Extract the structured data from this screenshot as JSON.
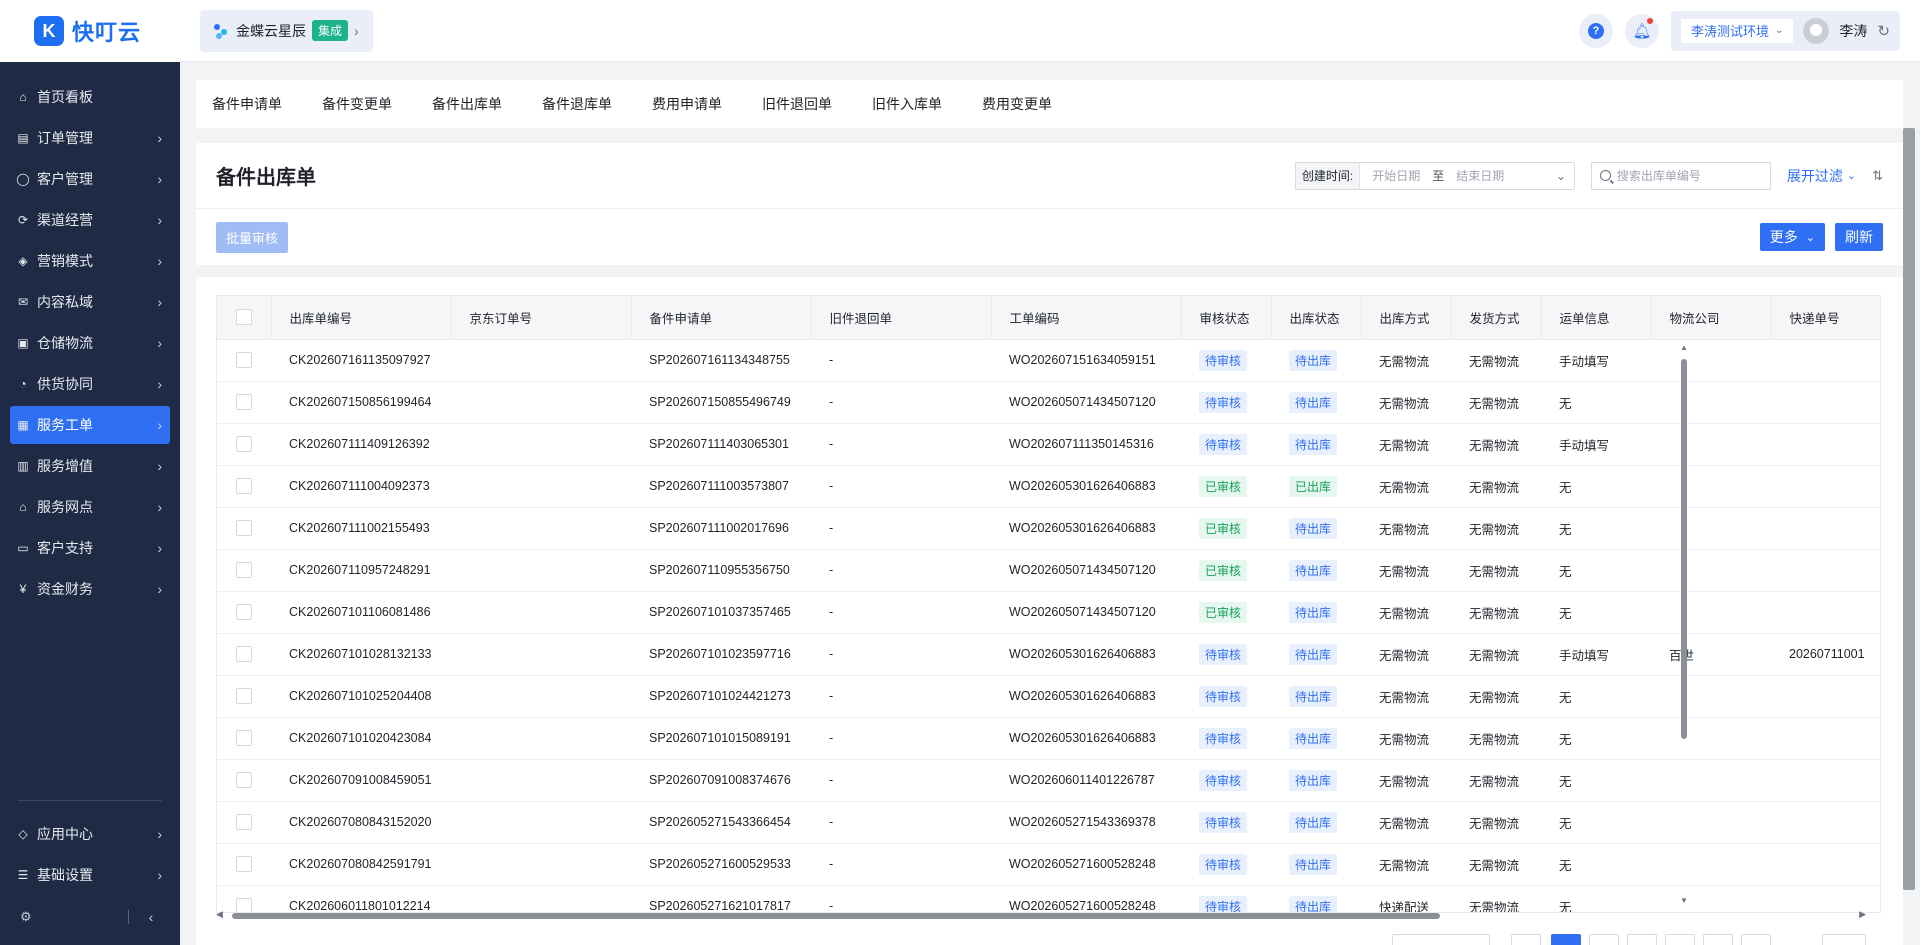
{
  "app": {
    "logo_text": "快叮云",
    "logo_mark": "K"
  },
  "header": {
    "brand": {
      "name": "金蝶云星辰",
      "tag": "集成"
    },
    "environment": "李涛测试环境",
    "user_name": "李涛"
  },
  "sidebar": {
    "items": [
      {
        "label": "首页看板",
        "icon": "home-icon",
        "has_arrow": false
      },
      {
        "label": "订单管理",
        "icon": "order-icon",
        "has_arrow": true
      },
      {
        "label": "客户管理",
        "icon": "customer-icon",
        "has_arrow": true
      },
      {
        "label": "渠道经营",
        "icon": "channel-icon",
        "has_arrow": true
      },
      {
        "label": "营销模式",
        "icon": "tag-icon",
        "has_arrow": true
      },
      {
        "label": "内容私域",
        "icon": "mail-icon",
        "has_arrow": true
      },
      {
        "label": "仓储物流",
        "icon": "warehouse-icon",
        "has_arrow": true
      },
      {
        "label": "供货协同",
        "icon": "supply-icon",
        "has_arrow": true
      },
      {
        "label": "服务工单",
        "icon": "workorder-icon",
        "has_arrow": true,
        "active": true
      },
      {
        "label": "服务增值",
        "icon": "bag-icon",
        "has_arrow": true
      },
      {
        "label": "服务网点",
        "icon": "store-icon",
        "has_arrow": true
      },
      {
        "label": "客户支持",
        "icon": "support-icon",
        "has_arrow": true
      },
      {
        "label": "资金财务",
        "icon": "finance-icon",
        "has_arrow": true
      }
    ],
    "bottom_items": [
      {
        "label": "应用中心",
        "icon": "app-center-icon"
      },
      {
        "label": "基础设置",
        "icon": "settings-icon"
      }
    ]
  },
  "tabs": [
    "备件申请单",
    "备件变更单",
    "备件出库单",
    "备件退库单",
    "费用申请单",
    "旧件退回单",
    "旧件入库单",
    "费用变更单"
  ],
  "page": {
    "title": "备件出库单",
    "date_filter": {
      "label": "创建时间:",
      "start_placeholder": "开始日期",
      "separator": "至",
      "end_placeholder": "结束日期"
    },
    "search_placeholder": "搜索出库单编号",
    "expand_filter": "展开过滤",
    "batch_audit": "批量审核",
    "more": "更多",
    "refresh": "刷新"
  },
  "table": {
    "columns": [
      "出库单编号",
      "京东订单号",
      "备件申请单",
      "旧件退回单",
      "工单编码",
      "审核状态",
      "出库状态",
      "出库方式",
      "发货方式",
      "运单信息",
      "物流公司",
      "快递单号"
    ],
    "rows": [
      {
        "id": "CK202607161135097927",
        "jd": "",
        "apply": "SP202607161134348755",
        "return": "-",
        "wo": "WO202607151634059151",
        "audit": "待审核",
        "out": "待出库",
        "out_method": "无需物流",
        "ship_method": "无需物流",
        "waybill": "手动填写",
        "carrier": "",
        "tracking": ""
      },
      {
        "id": "CK202607150856199464",
        "jd": "",
        "apply": "SP202607150855496749",
        "return": "-",
        "wo": "WO202605071434507120",
        "audit": "待审核",
        "out": "待出库",
        "out_method": "无需物流",
        "ship_method": "无需物流",
        "waybill": "无",
        "carrier": "",
        "tracking": ""
      },
      {
        "id": "CK202607111409126392",
        "jd": "",
        "apply": "SP202607111403065301",
        "return": "-",
        "wo": "WO202607111350145316",
        "audit": "待审核",
        "out": "待出库",
        "out_method": "无需物流",
        "ship_method": "无需物流",
        "waybill": "手动填写",
        "carrier": "",
        "tracking": ""
      },
      {
        "id": "CK202607111004092373",
        "jd": "",
        "apply": "SP202607111003573807",
        "return": "-",
        "wo": "WO202605301626406883",
        "audit": "已审核",
        "out": "已出库",
        "out_method": "无需物流",
        "ship_method": "无需物流",
        "waybill": "无",
        "carrier": "",
        "tracking": ""
      },
      {
        "id": "CK202607111002155493",
        "jd": "",
        "apply": "SP202607111002017696",
        "return": "-",
        "wo": "WO202605301626406883",
        "audit": "已审核",
        "out": "待出库",
        "out_method": "无需物流",
        "ship_method": "无需物流",
        "waybill": "无",
        "carrier": "",
        "tracking": ""
      },
      {
        "id": "CK202607110957248291",
        "jd": "",
        "apply": "SP202607110955356750",
        "return": "-",
        "wo": "WO202605071434507120",
        "audit": "已审核",
        "out": "待出库",
        "out_method": "无需物流",
        "ship_method": "无需物流",
        "waybill": "无",
        "carrier": "",
        "tracking": ""
      },
      {
        "id": "CK202607101106081486",
        "jd": "",
        "apply": "SP202607101037357465",
        "return": "-",
        "wo": "WO202605071434507120",
        "audit": "已审核",
        "out": "待出库",
        "out_method": "无需物流",
        "ship_method": "无需物流",
        "waybill": "无",
        "carrier": "",
        "tracking": ""
      },
      {
        "id": "CK202607101028132133",
        "jd": "",
        "apply": "SP202607101023597716",
        "return": "-",
        "wo": "WO202605301626406883",
        "audit": "待审核",
        "out": "待出库",
        "out_method": "无需物流",
        "ship_method": "无需物流",
        "waybill": "手动填写",
        "carrier": "百世",
        "tracking": "20260711001"
      },
      {
        "id": "CK202607101025204408",
        "jd": "",
        "apply": "SP202607101024421273",
        "return": "-",
        "wo": "WO202605301626406883",
        "audit": "待审核",
        "out": "待出库",
        "out_method": "无需物流",
        "ship_method": "无需物流",
        "waybill": "无",
        "carrier": "",
        "tracking": ""
      },
      {
        "id": "CK202607101020423084",
        "jd": "",
        "apply": "SP202607101015089191",
        "return": "-",
        "wo": "WO202605301626406883",
        "audit": "待审核",
        "out": "待出库",
        "out_method": "无需物流",
        "ship_method": "无需物流",
        "waybill": "无",
        "carrier": "",
        "tracking": ""
      },
      {
        "id": "CK202607091008459051",
        "jd": "",
        "apply": "SP202607091008374676",
        "return": "-",
        "wo": "WO202606011401226787",
        "audit": "待审核",
        "out": "待出库",
        "out_method": "无需物流",
        "ship_method": "无需物流",
        "waybill": "无",
        "carrier": "",
        "tracking": ""
      },
      {
        "id": "CK202607080843152020",
        "jd": "",
        "apply": "SP202605271543366454",
        "return": "-",
        "wo": "WO202605271543369378",
        "audit": "待审核",
        "out": "待出库",
        "out_method": "无需物流",
        "ship_method": "无需物流",
        "waybill": "无",
        "carrier": "",
        "tracking": ""
      },
      {
        "id": "CK202607080842591791",
        "jd": "",
        "apply": "SP202605271600529533",
        "return": "-",
        "wo": "WO202605271600528248",
        "audit": "待审核",
        "out": "待出库",
        "out_method": "无需物流",
        "ship_method": "无需物流",
        "waybill": "无",
        "carrier": "",
        "tracking": ""
      },
      {
        "id": "CK202606011801012214",
        "jd": "",
        "apply": "SP202605271621017817",
        "return": "-",
        "wo": "WO202605271600528248",
        "audit": "待审核",
        "out": "待出库",
        "out_method": "快递配送",
        "ship_method": "无需物流",
        "waybill": "无",
        "carrier": "",
        "tracking": ""
      }
    ]
  },
  "colors": {
    "sidebar_bg": "#1f2a44",
    "primary": "#2f6ff3",
    "success": "#14a05a"
  }
}
